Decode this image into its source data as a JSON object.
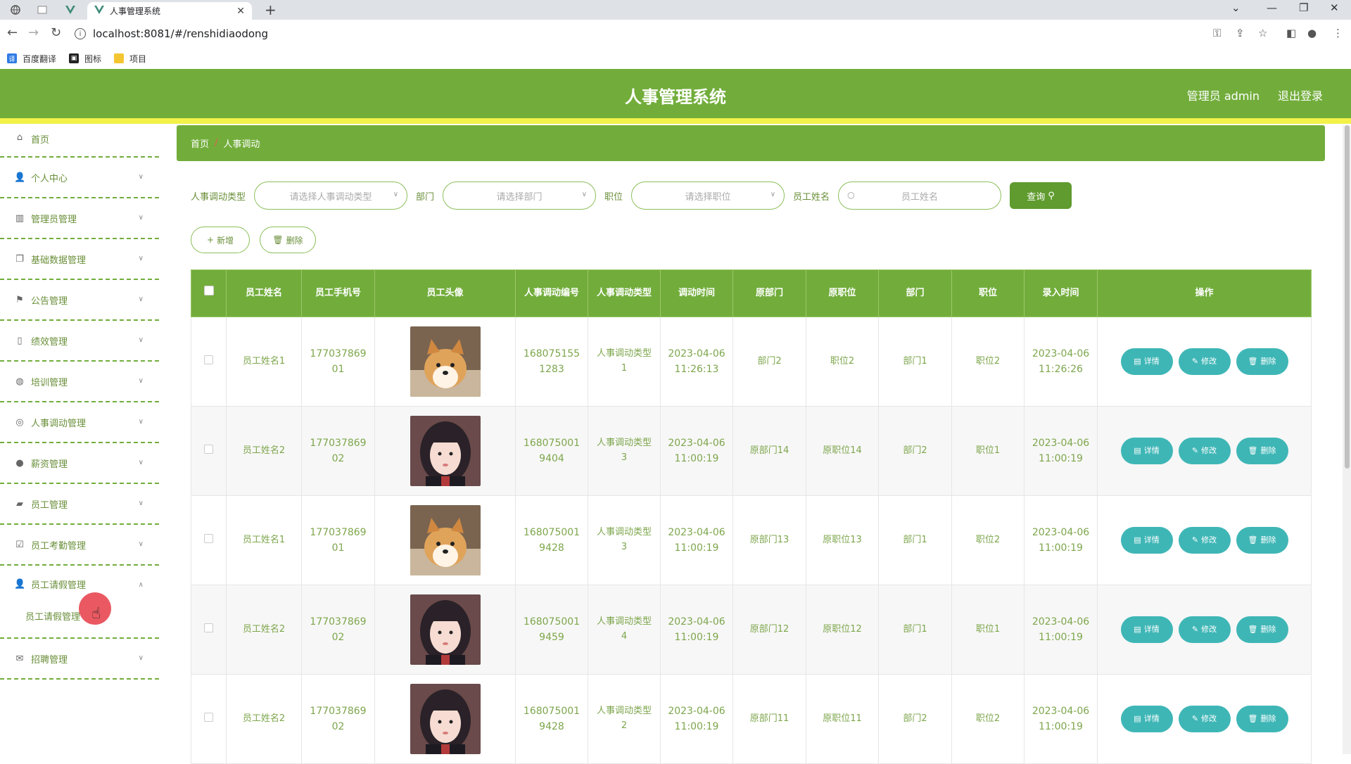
{
  "browser": {
    "tab_title": "人事管理系统",
    "url": "localhost:8081/#/renshidiaodong",
    "bookmarks": [
      "百度翻译",
      "图标",
      "项目"
    ]
  },
  "header": {
    "title": "人事管理系统",
    "user": "管理员 admin",
    "logout": "退出登录",
    "brand_color": "#72ad3b",
    "stripe_color": "#f2f24a"
  },
  "sidebar": {
    "items": [
      {
        "label": "首页",
        "icon": "home-icon"
      },
      {
        "label": "个人中心",
        "icon": "person-icon"
      },
      {
        "label": "管理员管理",
        "icon": "chart-icon"
      },
      {
        "label": "基础数据管理",
        "icon": "copy-icon"
      },
      {
        "label": "公告管理",
        "icon": "flag-icon"
      },
      {
        "label": "绩效管理",
        "icon": "phone-icon"
      },
      {
        "label": "培训管理",
        "icon": "globe-icon"
      },
      {
        "label": "人事调动管理",
        "icon": "circle-icon"
      },
      {
        "label": "薪资管理",
        "icon": "pin-icon"
      },
      {
        "label": "员工管理",
        "icon": "ticket-icon"
      },
      {
        "label": "员工考勤管理",
        "icon": "check-icon"
      },
      {
        "label": "员工请假管理",
        "icon": "user-icon"
      },
      {
        "label": "招聘管理",
        "icon": "mail-icon"
      }
    ],
    "open_submenu": "员工请假管理"
  },
  "breadcrumb": {
    "home": "首页",
    "current": "人事调动"
  },
  "search": {
    "type_label": "人事调动类型",
    "type_placeholder": "请选择人事调动类型",
    "dept_label": "部门",
    "dept_placeholder": "请选择部门",
    "pos_label": "职位",
    "pos_placeholder": "请选择职位",
    "name_label": "员工姓名",
    "name_placeholder": "员工姓名",
    "query_btn": "查询"
  },
  "actions": {
    "add": "新增",
    "delete": "删除"
  },
  "table": {
    "columns": [
      "员工姓名",
      "员工手机号",
      "员工头像",
      "人事调动编号",
      "人事调动类型",
      "调动时间",
      "原部门",
      "原职位",
      "部门",
      "职位",
      "录入时间",
      "操作"
    ],
    "op_labels": {
      "detail": "详情",
      "edit": "修改",
      "delete": "删除"
    },
    "rows": [
      {
        "name": "员工姓名1",
        "phone": "17703786901",
        "avatar": "dog",
        "code": "1680751551283",
        "type": "人事调动类型1",
        "time": "2023-04-06 11:26:13",
        "old_dept": "部门2",
        "old_pos": "职位2",
        "dept": "部门1",
        "pos": "职位2",
        "created": "2023-04-06 11:26:26"
      },
      {
        "name": "员工姓名2",
        "phone": "17703786902",
        "avatar": "girl",
        "code": "1680750019404",
        "type": "人事调动类型3",
        "time": "2023-04-06 11:00:19",
        "old_dept": "原部门14",
        "old_pos": "原职位14",
        "dept": "部门2",
        "pos": "职位1",
        "created": "2023-04-06 11:00:19"
      },
      {
        "name": "员工姓名1",
        "phone": "17703786901",
        "avatar": "dog",
        "code": "1680750019428",
        "type": "人事调动类型3",
        "time": "2023-04-06 11:00:19",
        "old_dept": "原部门13",
        "old_pos": "原职位13",
        "dept": "部门1",
        "pos": "职位2",
        "created": "2023-04-06 11:00:19"
      },
      {
        "name": "员工姓名2",
        "phone": "17703786902",
        "avatar": "girl",
        "code": "1680750019459",
        "type": "人事调动类型4",
        "time": "2023-04-06 11:00:19",
        "old_dept": "原部门12",
        "old_pos": "原职位12",
        "dept": "部门1",
        "pos": "职位1",
        "created": "2023-04-06 11:00:19"
      },
      {
        "name": "员工姓名2",
        "phone": "17703786902",
        "avatar": "girl",
        "code": "1680750019428",
        "type": "人事调动类型2",
        "time": "2023-04-06 11:00:19",
        "old_dept": "原部门11",
        "old_pos": "原职位11",
        "dept": "部门2",
        "pos": "职位2",
        "created": "2023-04-06 11:00:19"
      }
    ]
  }
}
